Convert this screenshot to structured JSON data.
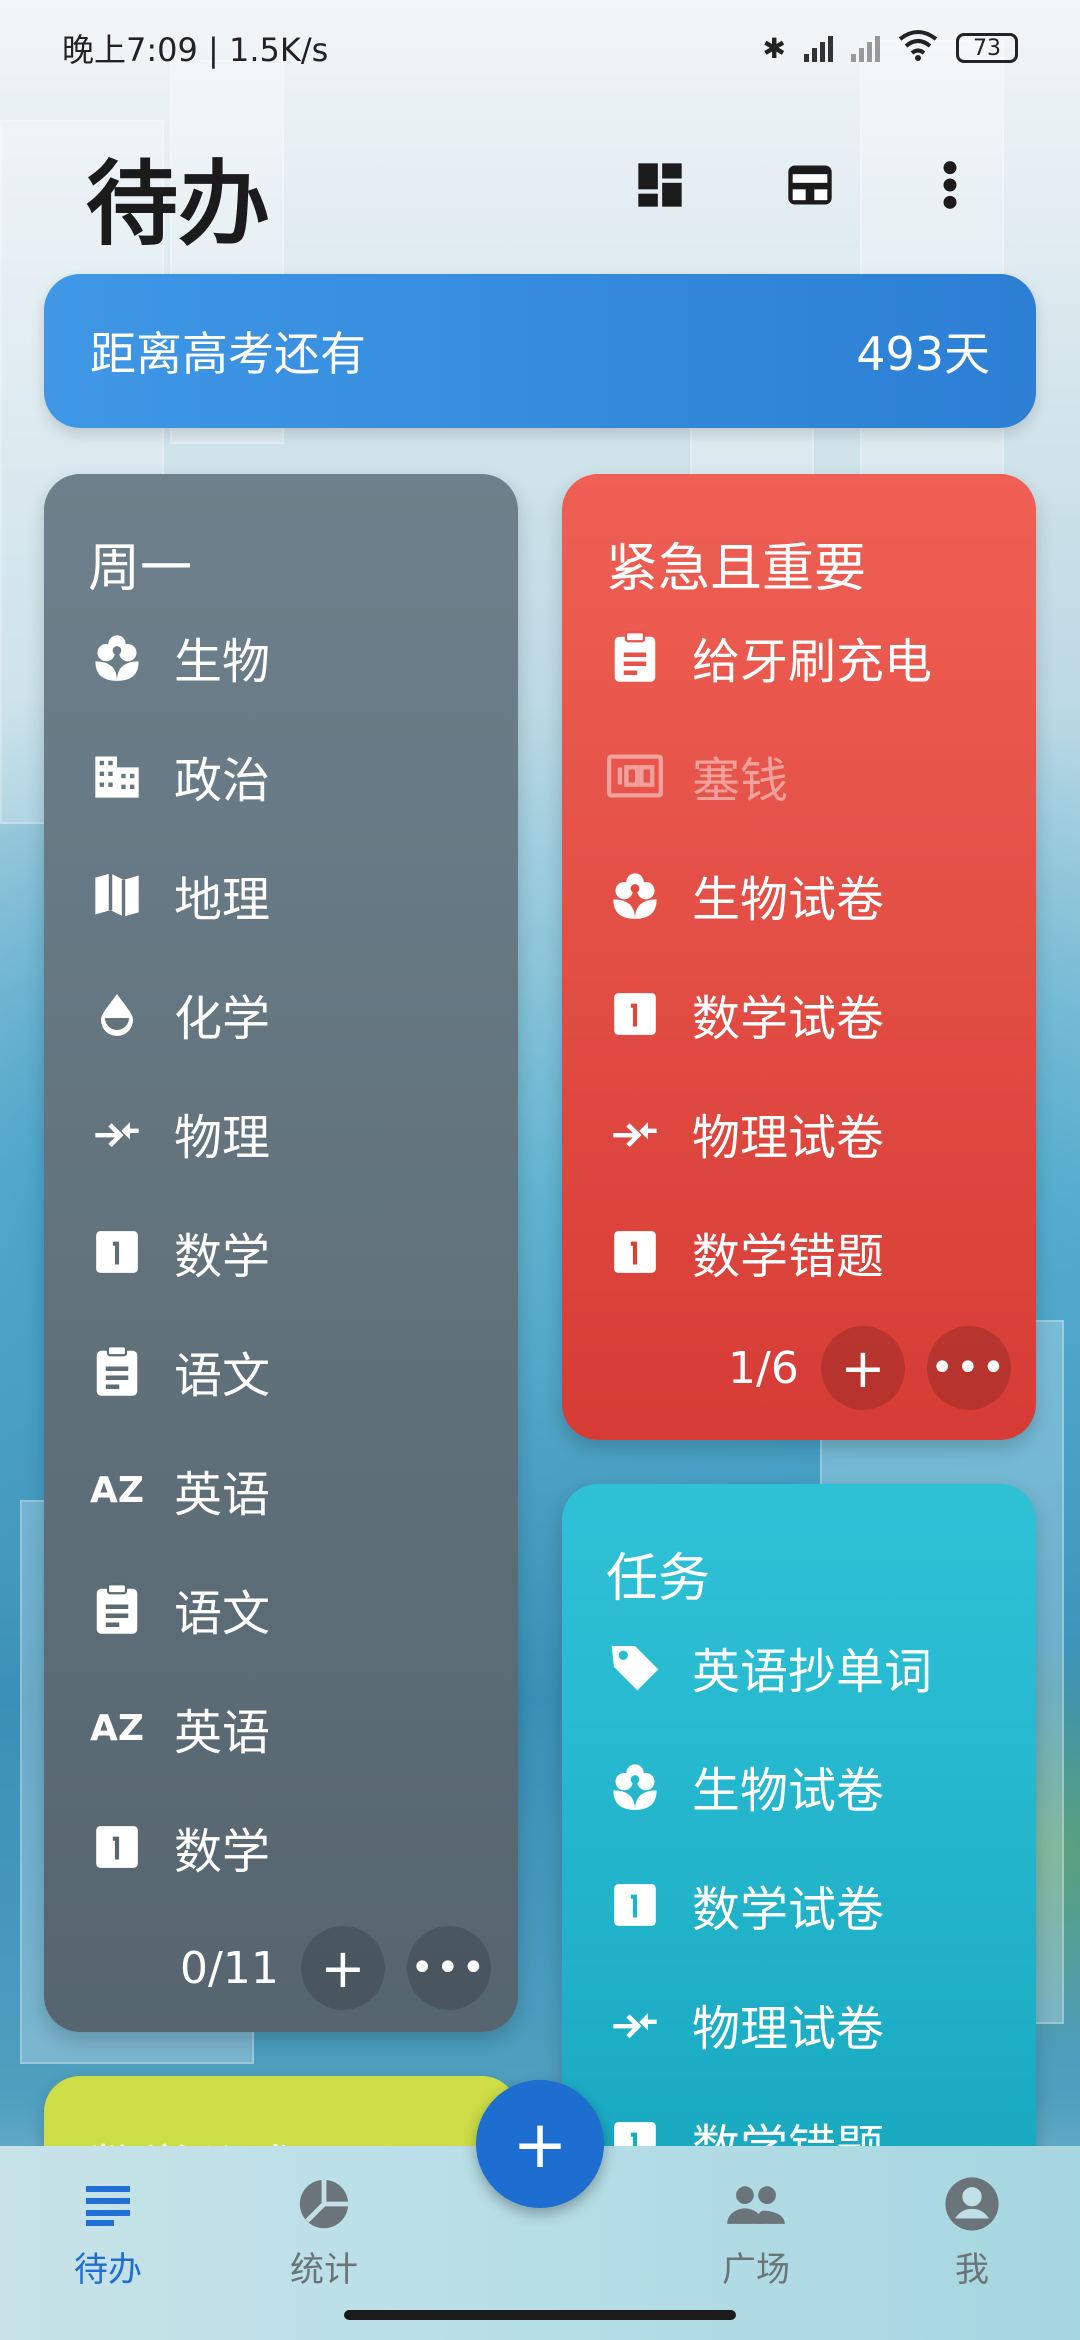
{
  "status_bar": {
    "time_speed": "晚上7:09 | 1.5K/s",
    "battery": "73"
  },
  "app_bar": {
    "title": "待办",
    "icons": [
      "dashboard-icon",
      "inbox-icon",
      "more-vertical-icon"
    ]
  },
  "countdown": {
    "label": "距离高考还有",
    "days": "493天"
  },
  "cards": {
    "monday": {
      "title": "周一",
      "items": [
        {
          "icon": "flower-icon",
          "label": "生物"
        },
        {
          "icon": "building-icon",
          "label": "政治"
        },
        {
          "icon": "map-icon",
          "label": "地理"
        },
        {
          "icon": "drop-icon",
          "label": "化学"
        },
        {
          "icon": "compare-arrows-icon",
          "label": "物理"
        },
        {
          "icon": "number-one-icon",
          "label": "数学"
        },
        {
          "icon": "clipboard-icon",
          "label": "语文"
        },
        {
          "icon": "sort-az-icon",
          "label": "英语"
        },
        {
          "icon": "clipboard-icon",
          "label": "语文"
        },
        {
          "icon": "sort-az-icon",
          "label": "英语"
        },
        {
          "icon": "number-one-icon",
          "label": "数学"
        }
      ],
      "progress": "0/11"
    },
    "urgent": {
      "title": "紧急且重要",
      "items": [
        {
          "icon": "clipboard-icon",
          "label": "给牙刷充电",
          "done": false
        },
        {
          "icon": "money-icon",
          "label": "塞钱",
          "done": true
        },
        {
          "icon": "flower-icon",
          "label": "生物试卷",
          "done": false
        },
        {
          "icon": "number-one-icon",
          "label": "数学试卷",
          "done": false
        },
        {
          "icon": "compare-arrows-icon",
          "label": "物理试卷",
          "done": false
        },
        {
          "icon": "number-one-icon",
          "label": "数学错题",
          "done": false
        }
      ],
      "progress": "1/6"
    },
    "tasks": {
      "title": "任务",
      "items": [
        {
          "icon": "tag-icon",
          "label": "英语抄单词"
        },
        {
          "icon": "flower-icon",
          "label": "生物试卷"
        },
        {
          "icon": "number-one-icon",
          "label": "数学试卷"
        },
        {
          "icon": "compare-arrows-icon",
          "label": "物理试卷"
        },
        {
          "icon": "number-one-icon",
          "label": "数学错题"
        }
      ]
    },
    "partial": {
      "title": "数学公式"
    }
  },
  "bottom_nav": {
    "items": [
      {
        "label": "待办",
        "icon": "list-icon",
        "active": true
      },
      {
        "label": "统计",
        "icon": "pie-chart-icon",
        "active": false
      },
      {
        "label": "广场",
        "icon": "people-icon",
        "active": false
      },
      {
        "label": "我",
        "icon": "account-icon",
        "active": false
      }
    ]
  },
  "fab": {
    "label": "+"
  },
  "colors": {
    "accent": "#1e6dd0",
    "monday": "#5f707b",
    "urgent": "#e24c43",
    "tasks": "#22b6cc",
    "banner": "#3588dc"
  }
}
